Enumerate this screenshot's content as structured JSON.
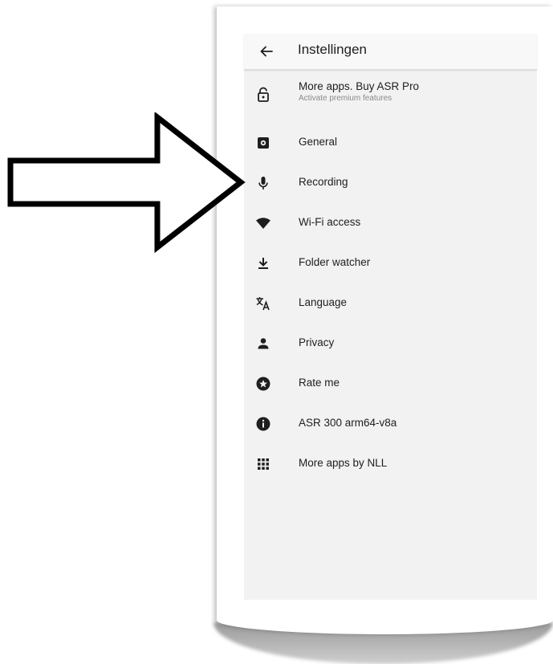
{
  "header": {
    "title": "Instellingen",
    "back_icon": "arrow-left-icon"
  },
  "menu": [
    {
      "id": "premium",
      "label": "More apps. Buy ASR Pro",
      "sublabel": "Activate premium features",
      "icon": "lock-open-icon"
    },
    {
      "id": "general",
      "label": "General",
      "icon": "gear-icon"
    },
    {
      "id": "recording",
      "label": "Recording",
      "icon": "microphone-icon"
    },
    {
      "id": "wifi",
      "label": "Wi-Fi access",
      "icon": "wifi-icon"
    },
    {
      "id": "folder-watcher",
      "label": "Folder watcher",
      "icon": "download-icon"
    },
    {
      "id": "language",
      "label": "Language",
      "icon": "translate-icon"
    },
    {
      "id": "privacy",
      "label": "Privacy",
      "icon": "person-icon"
    },
    {
      "id": "rate",
      "label": "Rate me",
      "icon": "star-circle-icon"
    },
    {
      "id": "about",
      "label": "ASR 300 arm64-v8a",
      "icon": "info-icon"
    },
    {
      "id": "more-apps",
      "label": "More apps by NLL",
      "icon": "apps-grid-icon"
    }
  ],
  "colors": {
    "screen_background": "#f2f2f2",
    "text": "#202020",
    "icon": "#1e1e1e",
    "annotation_arrow_stroke": "#000000"
  }
}
